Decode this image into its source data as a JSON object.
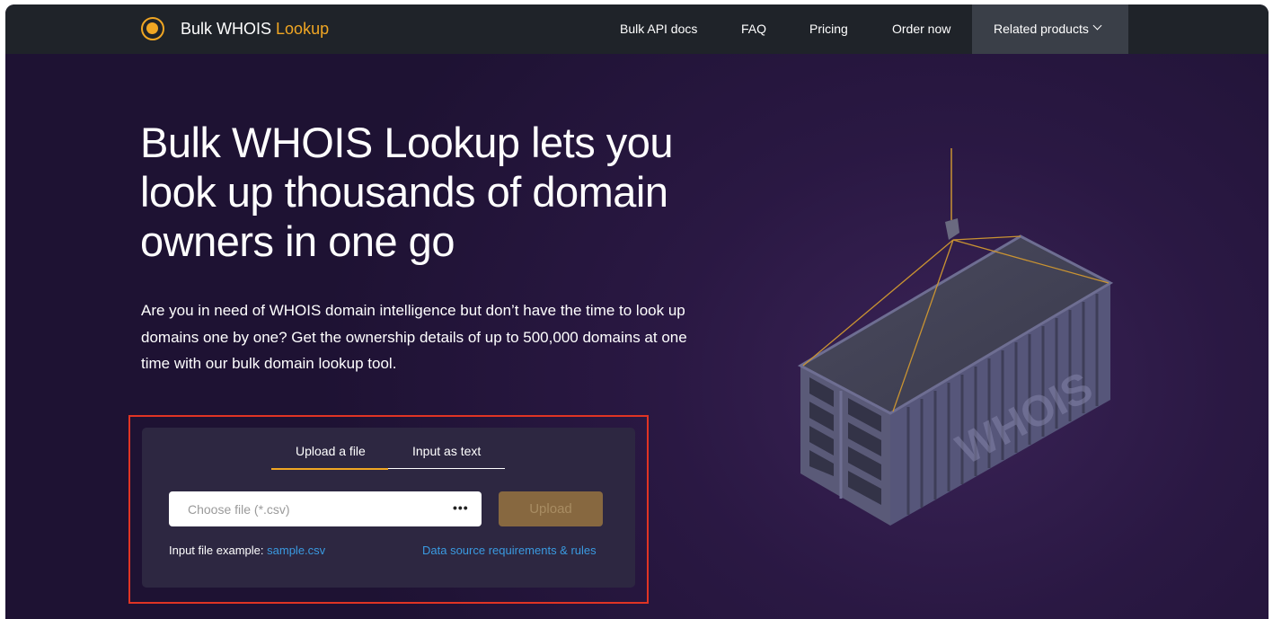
{
  "header": {
    "brand_main": "Bulk WHOIS",
    "brand_accent": "Lookup",
    "nav": [
      "Bulk API docs",
      "FAQ",
      "Pricing",
      "Order now"
    ],
    "related_products": "Related products"
  },
  "hero": {
    "title": "Bulk WHOIS Lookup lets you look up thousands of domain owners in one go",
    "description": "Are you in need of WHOIS domain intelligence but don’t have the time to look up domains one by one? Get the ownership details of up to 500,000 domains at one time with our bulk domain lookup tool."
  },
  "upload_panel": {
    "tabs": [
      "Upload a file",
      "Input as text"
    ],
    "active_tab": "Upload a file",
    "file_placeholder": "Choose file (*.csv)",
    "browse_icon": "•••",
    "upload_label": "Upload",
    "example_label": "Input file example:",
    "example_link": "sample.csv",
    "rules_link": "Data source requirements & rules"
  },
  "illustration": {
    "container_text": "WHOIS"
  },
  "colors": {
    "header_bg": "#1f2329",
    "accent": "#f0a623",
    "link": "#3a9ae0",
    "highlight": "#e03424"
  }
}
